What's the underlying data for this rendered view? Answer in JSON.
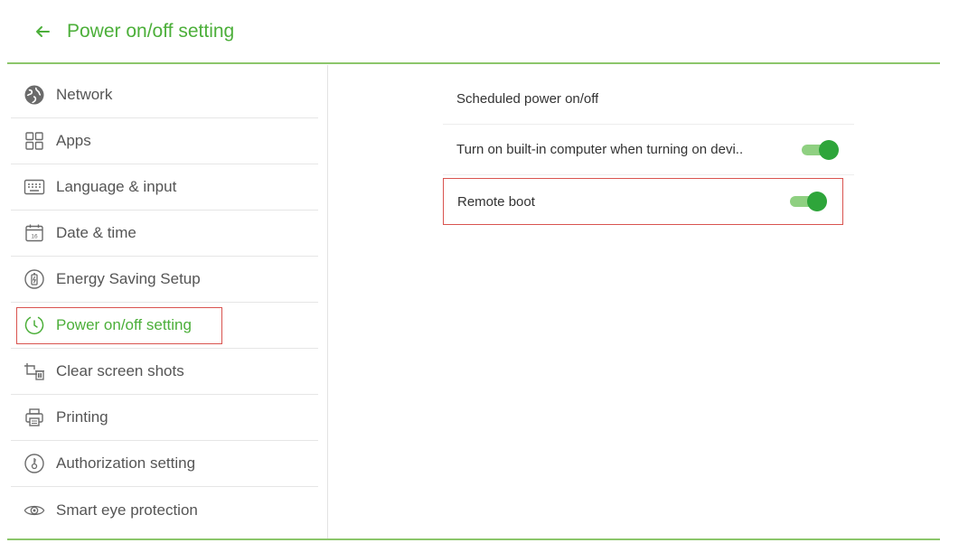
{
  "header": {
    "title": "Power on/off setting",
    "back_icon": "arrow-left-icon"
  },
  "colors": {
    "accent": "#4caf3a",
    "toggle_on": "#2ea53a",
    "highlight_box": "#d9534f"
  },
  "sidebar": {
    "items": [
      {
        "label": "Network",
        "icon": "globe-icon",
        "active": false
      },
      {
        "label": "Apps",
        "icon": "apps-grid-icon",
        "active": false
      },
      {
        "label": "Language & input",
        "icon": "keyboard-icon",
        "active": false
      },
      {
        "label": "Date & time",
        "icon": "calendar-icon",
        "active": false
      },
      {
        "label": "Energy Saving Setup",
        "icon": "battery-icon",
        "active": false
      },
      {
        "label": "Power on/off setting",
        "icon": "power-timer-icon",
        "active": true
      },
      {
        "label": "Clear screen shots",
        "icon": "crop-trash-icon",
        "active": false
      },
      {
        "label": "Printing",
        "icon": "printer-icon",
        "active": false
      },
      {
        "label": "Authorization setting",
        "icon": "key-icon",
        "active": false
      },
      {
        "label": "Smart eye protection",
        "icon": "eye-icon",
        "active": false
      }
    ]
  },
  "settings": [
    {
      "label": "Scheduled power on/off",
      "toggle": null
    },
    {
      "label": "Turn on built-in computer when turning on devi..",
      "toggle": true
    },
    {
      "label": "Remote boot",
      "toggle": true
    }
  ]
}
